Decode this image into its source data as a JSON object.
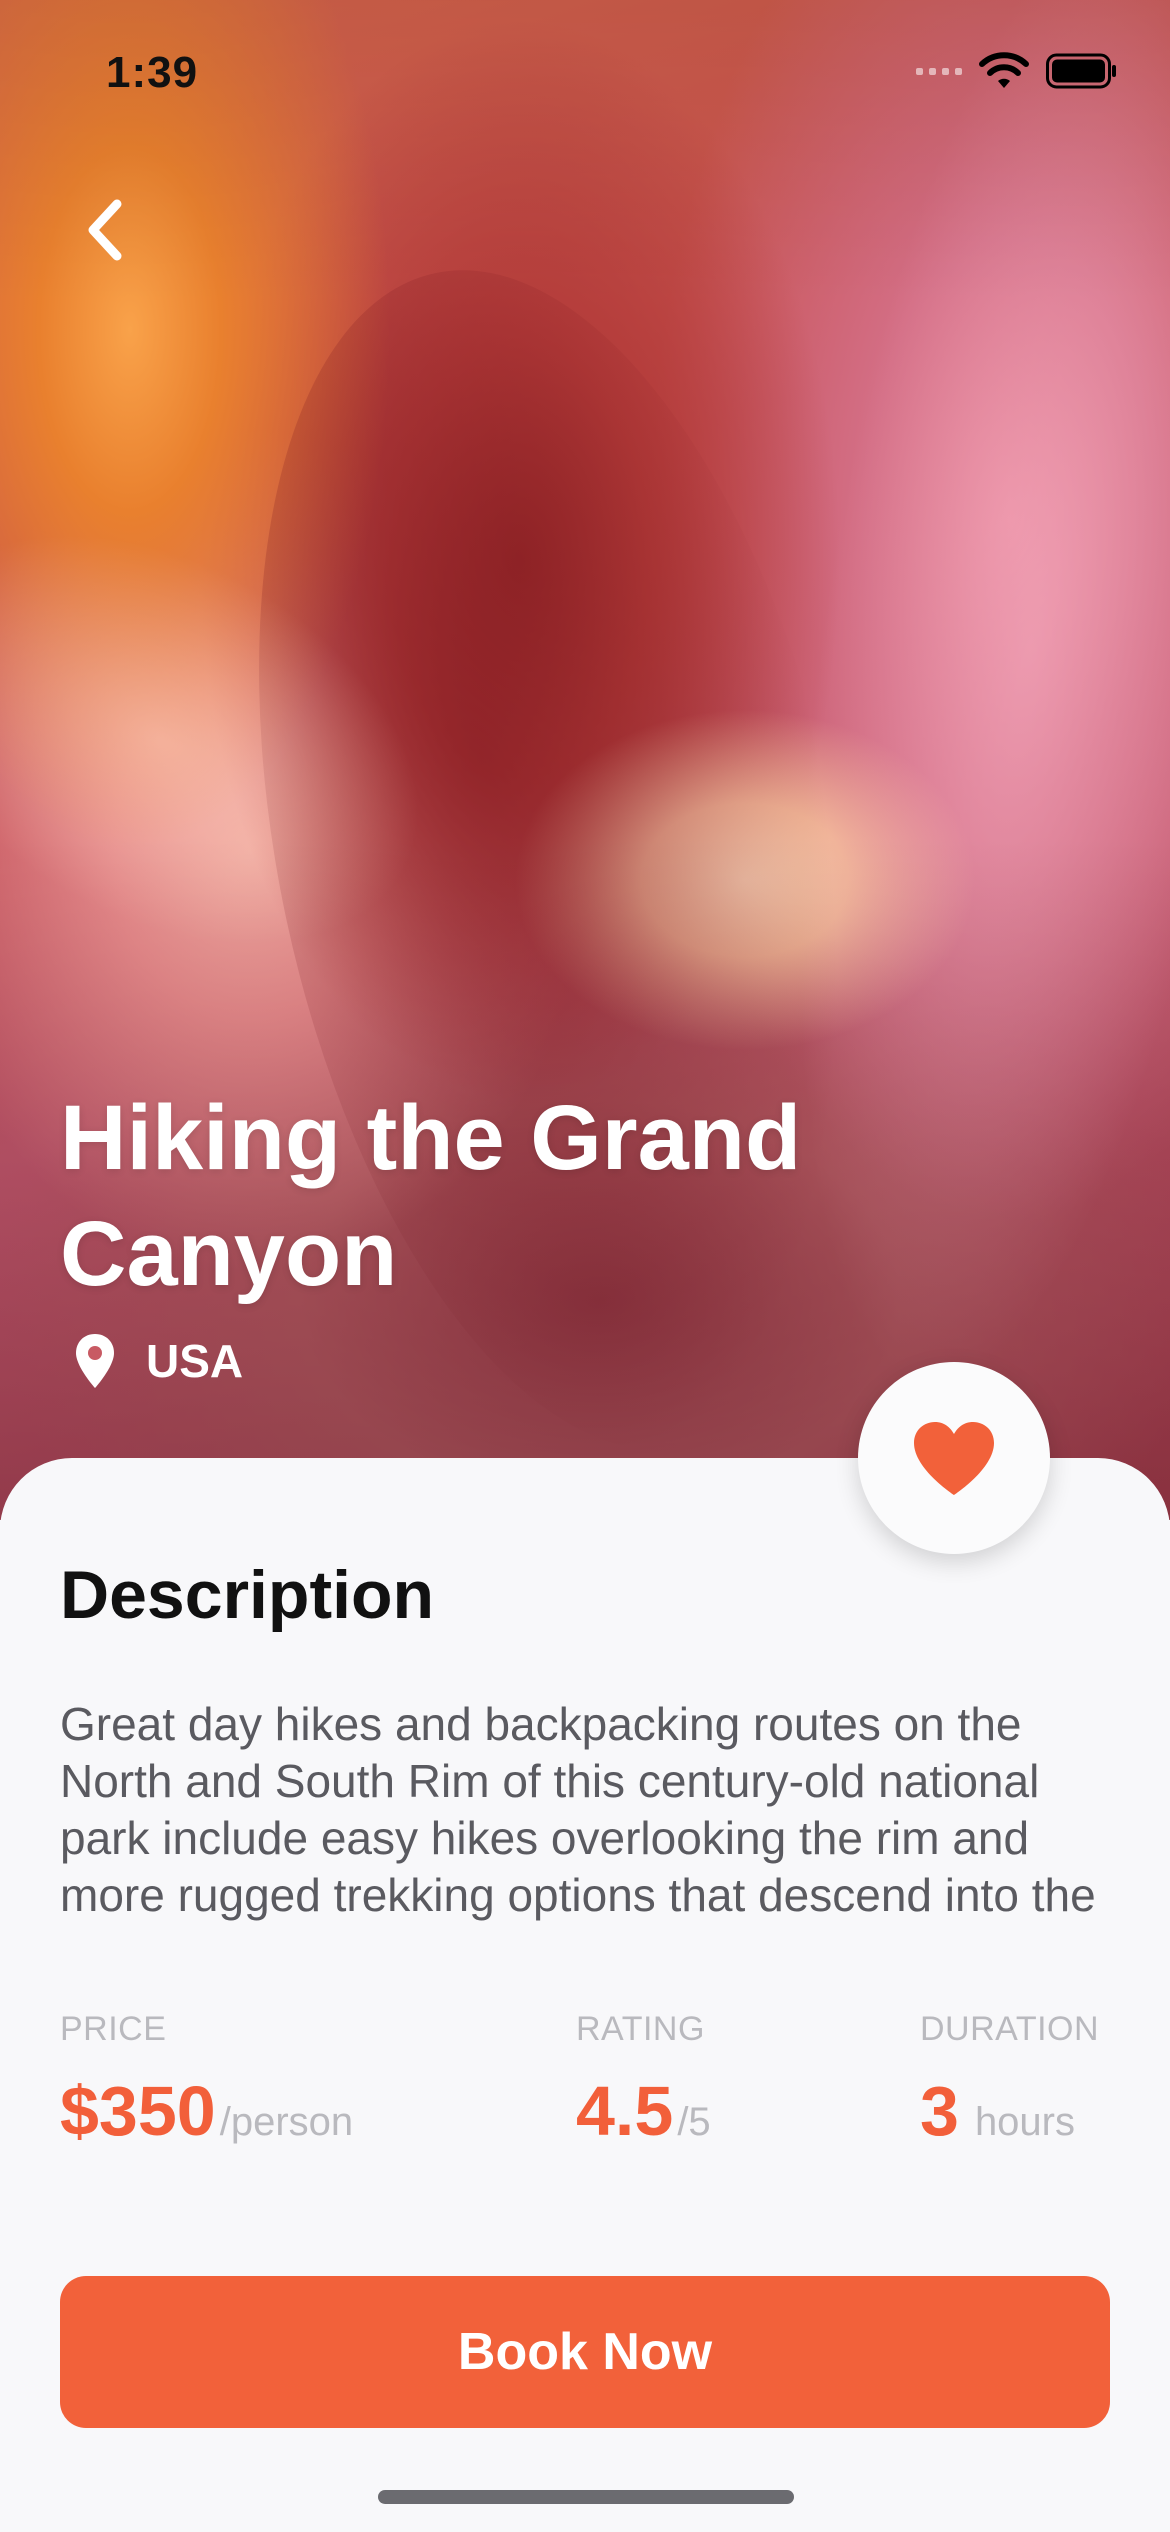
{
  "status_bar": {
    "time": "1:39"
  },
  "trip": {
    "title": "Hiking the Grand Canyon",
    "location": "USA"
  },
  "description": {
    "heading": "Description",
    "body": "Great day hikes and backpacking routes on the North and South Rim of this century-old national park include easy hikes overlooking the rim and more rugged trekking options that descend into the canyon."
  },
  "stats": {
    "price": {
      "label": "PRICE",
      "value": "$350",
      "unit": "/person"
    },
    "rating": {
      "label": "RATING",
      "value": "4.5",
      "unit": "/5"
    },
    "duration": {
      "label": "DURATION",
      "value": "3",
      "unit": "hours"
    }
  },
  "actions": {
    "book_label": "Book Now",
    "favorited": true
  },
  "colors": {
    "accent": "#f2613a",
    "background": "#f8f8fa"
  },
  "icons": {
    "back": "chevron-left-icon",
    "location": "map-pin-icon",
    "favorite": "heart-icon",
    "wifi": "wifi-icon",
    "battery": "battery-icon"
  }
}
